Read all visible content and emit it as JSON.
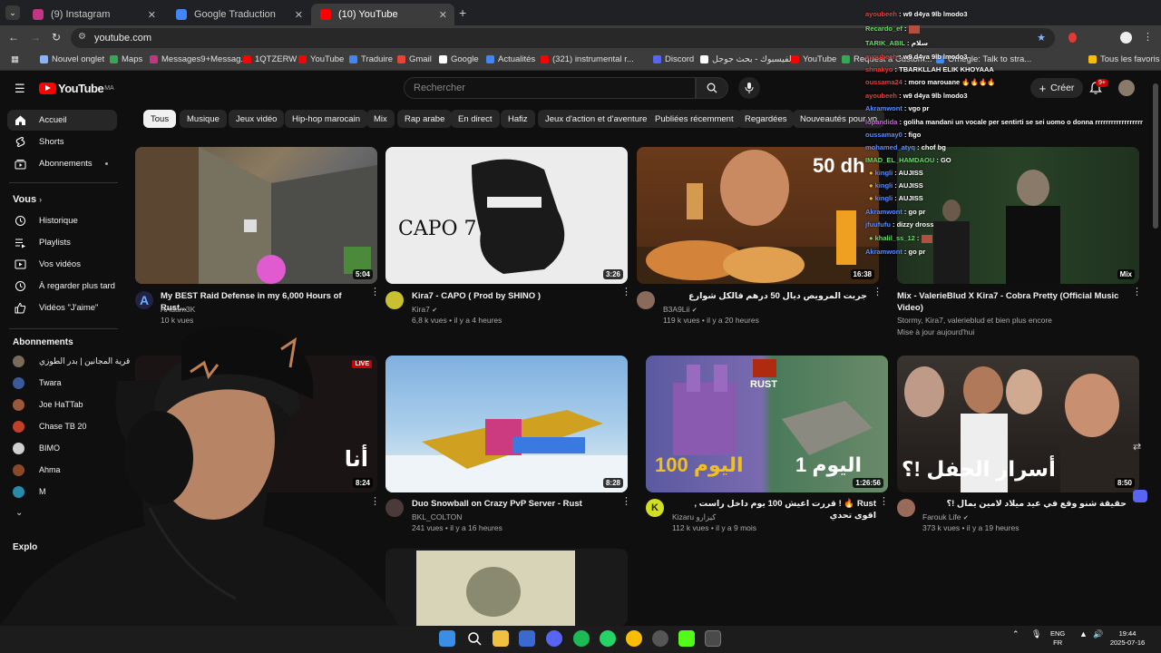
{
  "browser": {
    "tabs": [
      {
        "label": "(9) Instagram",
        "color": "#c13584"
      },
      {
        "label": "Google Traduction",
        "color": "#4285f4"
      },
      {
        "label": "(10) YouTube",
        "color": "#ff0000"
      }
    ],
    "url": "youtube.com",
    "bookmarks": [
      "Nouvel onglet",
      "Maps",
      "Messages9+Messag...",
      "1QTZERW",
      "YouTube",
      "Traduire",
      "Gmail",
      "Google",
      "Actualités",
      "(321) instrumental r...",
      "Discord",
      "الفيسبوك - بحث جوجل",
      "YouTube",
      "Request a Custom...",
      "Omegle: Talk to stra...",
      "Tous les favoris"
    ]
  },
  "header": {
    "logo": "YouTube",
    "region": "MA",
    "search_placeholder": "Rechercher",
    "create_label": "Créer",
    "notif_count": "9+"
  },
  "chips": [
    "Tous",
    "Musique",
    "Jeux vidéo",
    "Hip-hop marocain",
    "Mix",
    "Rap arabe",
    "En direct",
    "Hafiz",
    "Jeux d'action et d'aventure",
    "Publiées récemment",
    "Regardées",
    "Nouveautés pour vo"
  ],
  "sidebar": {
    "main": [
      {
        "label": "Accueil",
        "icon": "home-icon"
      },
      {
        "label": "Shorts",
        "icon": "shorts-icon"
      },
      {
        "label": "Abonnements",
        "icon": "subscriptions-icon"
      }
    ],
    "you_heading": "Vous",
    "you": [
      {
        "label": "Historique",
        "icon": "history-icon"
      },
      {
        "label": "Playlists",
        "icon": "playlists-icon"
      },
      {
        "label": "Vos vidéos",
        "icon": "your-videos-icon"
      },
      {
        "label": "À regarder plus tard",
        "icon": "watch-later-icon"
      },
      {
        "label": "Vidéos \"J'aime\"",
        "icon": "liked-icon"
      }
    ],
    "subs_heading": "Abonnements",
    "subs": [
      {
        "label": "قرية المجانين | بدر الطوزي",
        "color": "#7a6a5a"
      },
      {
        "label": "Twara",
        "color": "#3a5a9a"
      },
      {
        "label": "Joe HaTTab",
        "color": "#9a5a3a"
      },
      {
        "label": "Chase TB 20",
        "color": "#c0402a"
      },
      {
        "label": "BIMO",
        "color": "#d0d0d0"
      },
      {
        "label": "Ahma",
        "color": "#8a4a2a"
      },
      {
        "label": "M",
        "color": "#2a8aaa"
      }
    ],
    "explore_heading": "Explo"
  },
  "videos": [
    {
      "title": "My BEST Raid Defense in my 6,000 Hours of Rust...",
      "channel": "AAdam3K",
      "meta": "10 k vues",
      "duration": "5:04"
    },
    {
      "title": "Kira7 - CAPO ( Prod by SHINO )",
      "channel": "Kira7",
      "meta": "6,8 k vues • il y a 4 heures",
      "duration": "3:26",
      "thumb_text": "CAPO 7"
    },
    {
      "title": "جربت المرويص ديال 50 درهم فالكل شوارع",
      "channel": "B3A9Lii",
      "meta": "119 k vues • il y a 20 heures",
      "duration": "16:38",
      "thumb_text": "50 dh"
    },
    {
      "title": "Mix - ValerieBlud X Kira7 - Cobra Pretty (Official Music Video)",
      "channel": "Stormy, Kira7, valerieblud et bien plus encore",
      "meta": "Mise à jour aujourd'hui",
      "duration": "Mix"
    },
    {
      "title": "",
      "channel": "",
      "meta": "",
      "duration": "8:24",
      "live": "LIVE",
      "thumb_text": "أنا"
    },
    {
      "title": "Duo Snowball on Crazy PvP Server - Rust",
      "channel": "BKL_COLTON",
      "meta": "241 vues • il y a 16 heures",
      "duration": "8:28"
    },
    {
      "title": "Rust 🔥 ! قررت اعيش 100 يوم داخل راست , اقوى تحدي",
      "channel": "Kizaru كيزارو",
      "meta": "112 k vues • il y a 9 mois",
      "duration": "1:26:56",
      "thumb_text": "اليوم 100",
      "thumb_text2": "اليوم 1",
      "thumb_label": "RUST"
    },
    {
      "title": "حقيقة شنو وقع في عيد ميلاد لامين يمال !؟",
      "channel": "Farouk Life",
      "meta": "373 k vues • il y a 19 heures",
      "duration": "8:50",
      "thumb_text": "أسرار الحفل !؟"
    }
  ],
  "chat": [
    {
      "user": "ayoubeeh",
      "msg": "w9 d4ya 9lb lmodo3",
      "color": "#e04040"
    },
    {
      "user": "Recardo_ef",
      "msg": ":",
      "color": "#6cd96c"
    },
    {
      "user": "TARIK_ABIL",
      "msg": "سلام",
      "color": "#6cd96c"
    },
    {
      "user": "ayoubeeh",
      "msg": "w9 d4ya 9lb lmodo3",
      "color": "#e04040"
    },
    {
      "user": "shnakyo",
      "msg": "TBARKLLAH ELIK KHOYAAA",
      "color": "#e04040"
    },
    {
      "user": "oussama24",
      "msg": "moro marouane 🔥🔥🔥🔥",
      "color": "#e04040"
    },
    {
      "user": "ayoubeeh",
      "msg": "w9 d4ya 9lb lmodo3",
      "color": "#e04040"
    },
    {
      "user": "Akramwont",
      "msg": "vgo pr",
      "color": "#5a8cff"
    },
    {
      "user": "lopandida",
      "msg": "goliha mandani un vocale per sentirti se sei uomo o donna rrrrrrrrrrrrrrrrrr",
      "color": "#c06ad0"
    },
    {
      "user": "oussamay0",
      "msg": "figo",
      "color": "#5a8cff"
    },
    {
      "user": "mohamed_atyq",
      "msg": "chof bg",
      "color": "#5a8cff"
    },
    {
      "user": "IMAD_EL_HAMDAOU",
      "msg": "GO",
      "color": "#6cd96c"
    },
    {
      "user": "kingli",
      "msg": "AUJISS",
      "color": "#5a8cff"
    },
    {
      "user": "kingli",
      "msg": "AUJISS",
      "color": "#5a8cff"
    },
    {
      "user": "kingli",
      "msg": "AUJISS",
      "color": "#5a8cff"
    },
    {
      "user": "Akramwont",
      "msg": "go pr",
      "color": "#5a8cff"
    },
    {
      "user": "jfuufufu",
      "msg": "dizzy dross",
      "color": "#5a8cff"
    },
    {
      "user": "khalil_ss_12",
      "msg": ":",
      "color": "#6cd96c"
    },
    {
      "user": "Akramwont",
      "msg": "go pr",
      "color": "#5a8cff"
    }
  ],
  "taskbar": {
    "lang": "ENG",
    "region": "FR",
    "time": "19:44",
    "date": "2025-07-16"
  }
}
